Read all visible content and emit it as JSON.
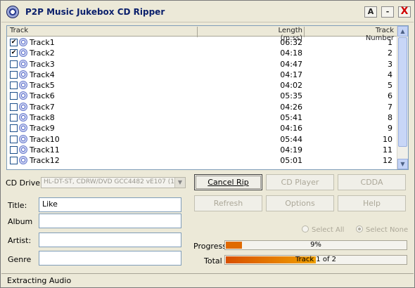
{
  "window": {
    "title": "P2P Music Jukebox CD Ripper",
    "about_btn": "A",
    "min_btn": "-",
    "close_btn": "X"
  },
  "list": {
    "headers": {
      "track": "Track",
      "length": "Length (m:ss)",
      "number": "Track Number"
    },
    "rows": [
      {
        "name": "Track1",
        "length": "06:32",
        "num": "1",
        "checked": true
      },
      {
        "name": "Track2",
        "length": "04:18",
        "num": "2",
        "checked": true
      },
      {
        "name": "Track3",
        "length": "04:47",
        "num": "3",
        "checked": false
      },
      {
        "name": "Track4",
        "length": "04:17",
        "num": "4",
        "checked": false
      },
      {
        "name": "Track5",
        "length": "04:02",
        "num": "5",
        "checked": false
      },
      {
        "name": "Track6",
        "length": "05:35",
        "num": "6",
        "checked": false
      },
      {
        "name": "Track7",
        "length": "04:26",
        "num": "7",
        "checked": false
      },
      {
        "name": "Track8",
        "length": "05:41",
        "num": "8",
        "checked": false
      },
      {
        "name": "Track9",
        "length": "04:16",
        "num": "9",
        "checked": false
      },
      {
        "name": "Track10",
        "length": "05:44",
        "num": "10",
        "checked": false
      },
      {
        "name": "Track11",
        "length": "04:19",
        "num": "11",
        "checked": false
      },
      {
        "name": "Track12",
        "length": "05:01",
        "num": "12",
        "checked": false
      }
    ]
  },
  "drive": {
    "label": "CD Drive:",
    "value": "HL-DT-ST, CDRW/DVD GCC4482 vE107 (1:"
  },
  "buttons": {
    "cancel_rip": "Cancel Rip",
    "cd_player": "CD Player",
    "cdda": "CDDA",
    "refresh": "Refresh",
    "options": "Options",
    "help": "Help"
  },
  "fields": {
    "title_label": "Title:",
    "title_value": "Like",
    "album_label": "Album",
    "album_value": "",
    "artist_label": "Artist:",
    "artist_value": "",
    "genre_label": "Genre",
    "genre_value": ""
  },
  "radios": {
    "select_all": "Select All",
    "select_none": "Select None",
    "selected": "select_none"
  },
  "progress": {
    "label": "Progress",
    "text": "9%",
    "value": 0.09
  },
  "total": {
    "label": "Total",
    "text": "Track  1 of 2",
    "value": 0.5
  },
  "status": "Extracting Audio",
  "colors": {
    "progress_fill": "#e06a00",
    "total_fill_start": "#d85000",
    "total_fill_end": "#f0a000"
  }
}
